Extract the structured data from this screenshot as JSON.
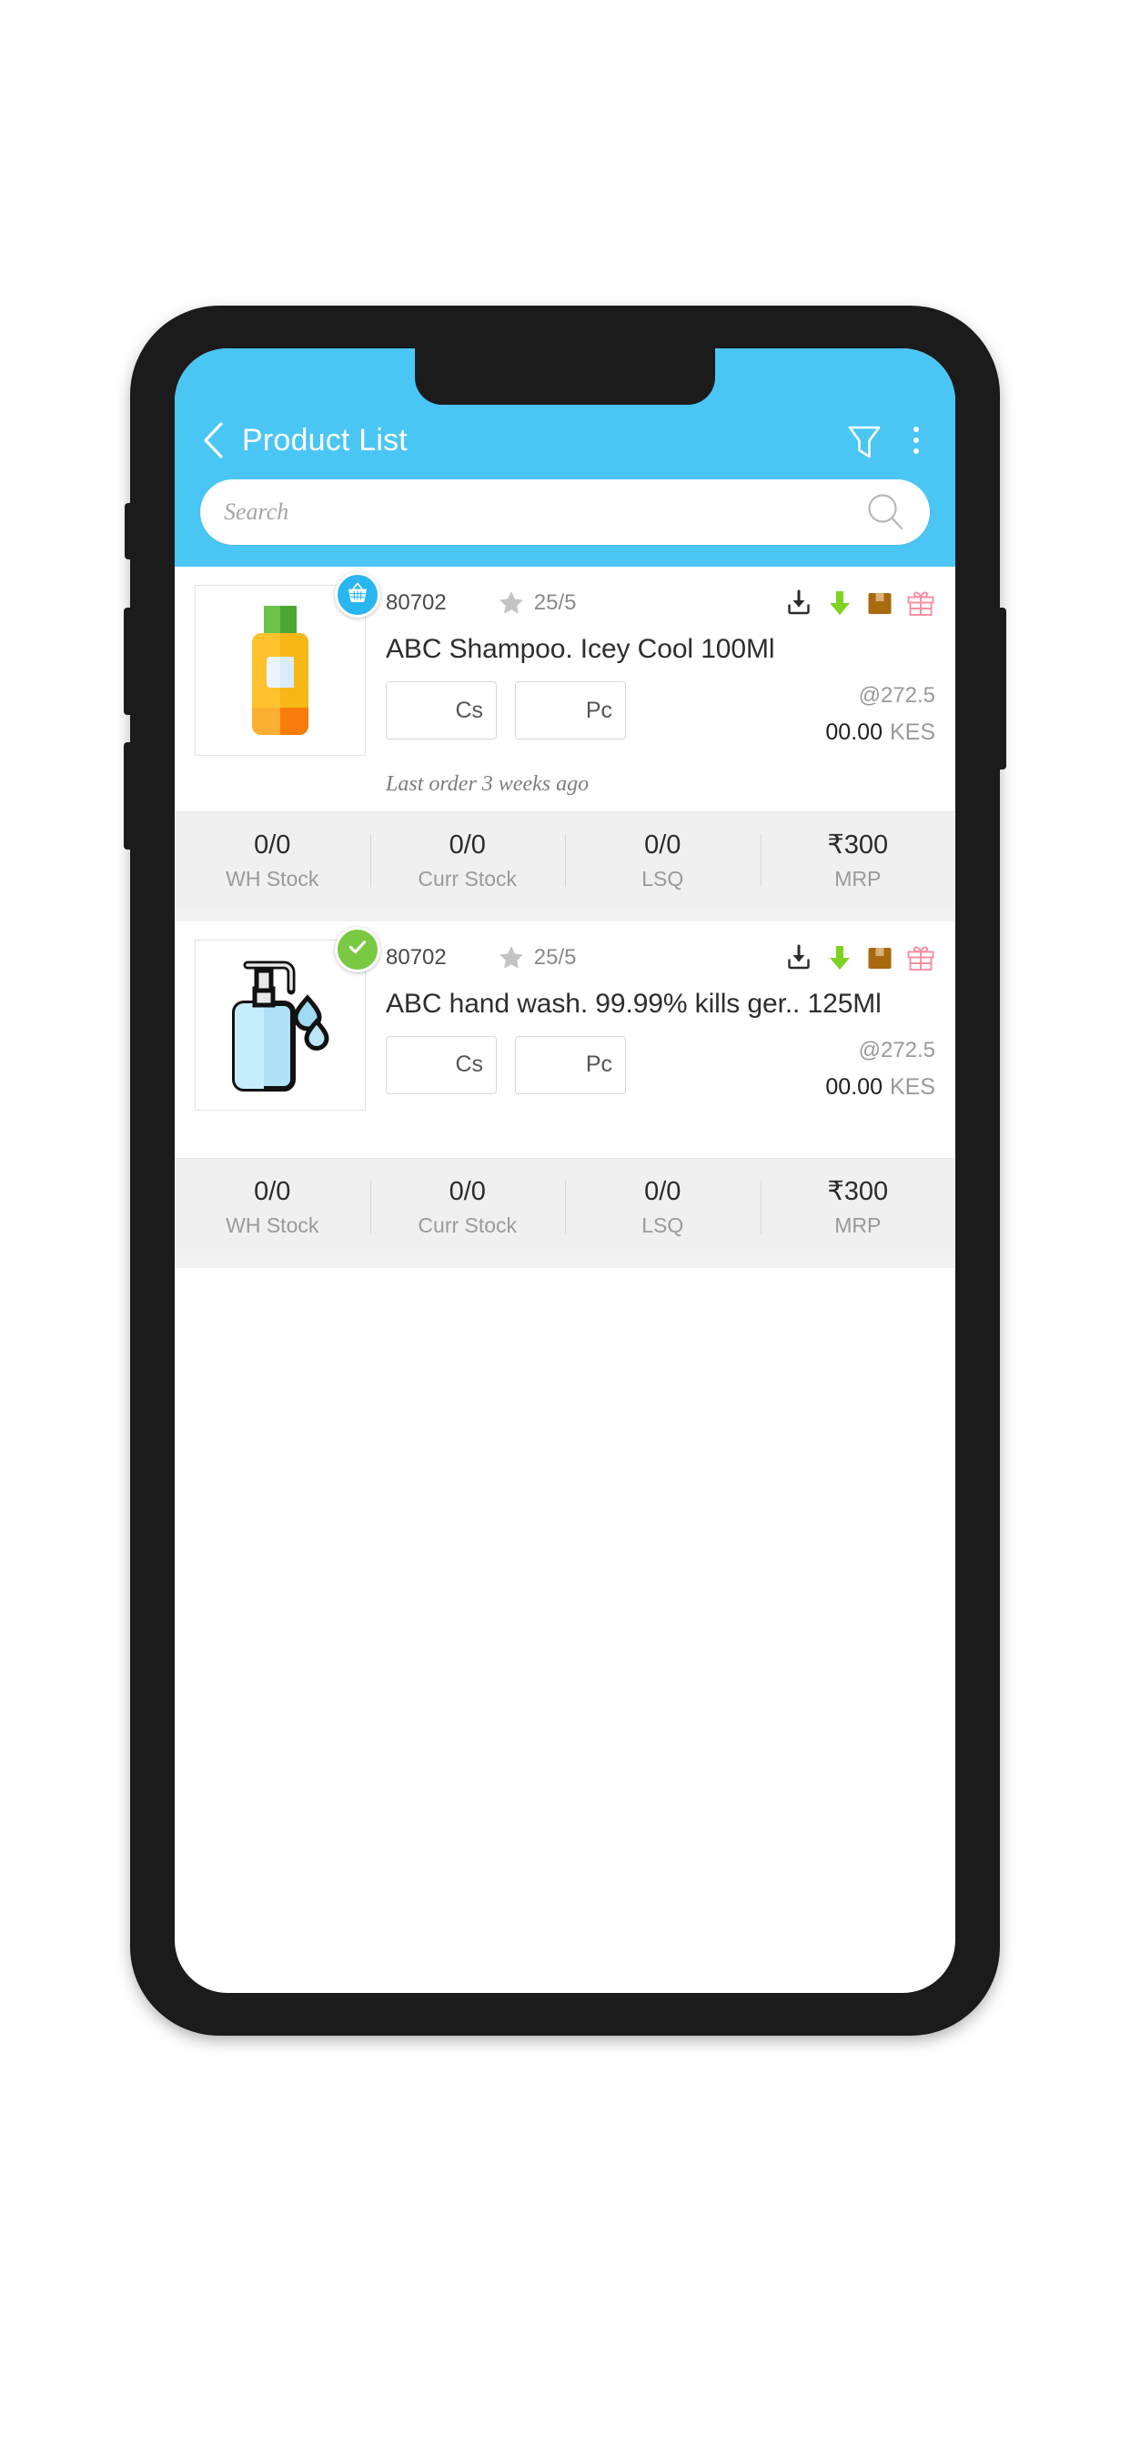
{
  "header": {
    "title": "Product List",
    "back_icon": "chevron-left-icon",
    "filter_icon": "filter-funnel-icon",
    "menu_icon": "overflow-menu-icon",
    "accent_color": "#4ac6f5"
  },
  "search": {
    "placeholder": "Search",
    "value": "",
    "icon": "search-icon"
  },
  "stat_labels": [
    "WH Stock",
    "Curr Stock",
    "LSQ",
    "MRP"
  ],
  "action_icons": [
    {
      "name": "download-icon",
      "color": "#2b2b2b"
    },
    {
      "name": "down-arrow-icon",
      "color": "#7ed321"
    },
    {
      "name": "box-icon",
      "color": "#b0721c"
    },
    {
      "name": "gift-icon",
      "color": "#f48fa0"
    }
  ],
  "products": [
    {
      "sku": "80702",
      "rating": "25/5",
      "rating_icon": "star-icon",
      "title": "ABC Shampoo. Icey Cool 100Ml",
      "image_icon": "shampoo-bottle-icon",
      "badge": {
        "type": "cart",
        "icon": "basket-icon",
        "color": "#29b6f0"
      },
      "unit_primary": {
        "label": "Cs",
        "value": ""
      },
      "unit_secondary": {
        "label": "Pc",
        "value": ""
      },
      "rate": "@272.5",
      "amount": "00.00",
      "currency": "KES",
      "last_order": "Last order 3 weeks ago",
      "stats": [
        "0/0",
        "0/0",
        "0/0",
        "₹300"
      ]
    },
    {
      "sku": "80702",
      "rating": "25/5",
      "rating_icon": "star-icon",
      "title": "ABC hand wash. 99.99% kills ger.. 125Ml",
      "image_icon": "handwash-bottle-icon",
      "badge": {
        "type": "check",
        "icon": "check-icon",
        "color": "#7ac943"
      },
      "unit_primary": {
        "label": "Cs",
        "value": ""
      },
      "unit_secondary": {
        "label": "Pc",
        "value": ""
      },
      "rate": "@272.5",
      "amount": "00.00",
      "currency": "KES",
      "last_order": "",
      "stats": [
        "0/0",
        "0/0",
        "0/0",
        "₹300"
      ]
    }
  ]
}
